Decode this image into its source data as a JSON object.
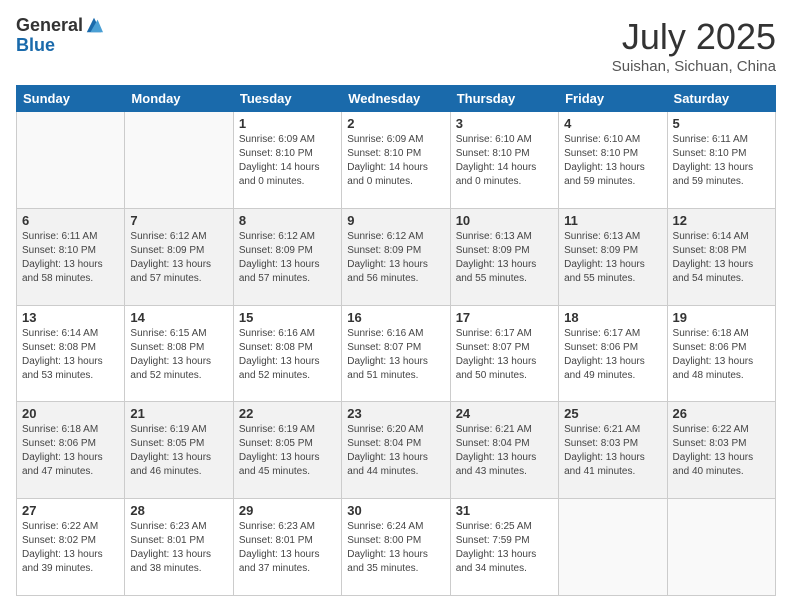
{
  "header": {
    "logo_general": "General",
    "logo_blue": "Blue",
    "month": "July 2025",
    "location": "Suishan, Sichuan, China"
  },
  "weekdays": [
    "Sunday",
    "Monday",
    "Tuesday",
    "Wednesday",
    "Thursday",
    "Friday",
    "Saturday"
  ],
  "weeks": [
    [
      {
        "day": "",
        "info": ""
      },
      {
        "day": "",
        "info": ""
      },
      {
        "day": "1",
        "info": "Sunrise: 6:09 AM\nSunset: 8:10 PM\nDaylight: 14 hours\nand 0 minutes."
      },
      {
        "day": "2",
        "info": "Sunrise: 6:09 AM\nSunset: 8:10 PM\nDaylight: 14 hours\nand 0 minutes."
      },
      {
        "day": "3",
        "info": "Sunrise: 6:10 AM\nSunset: 8:10 PM\nDaylight: 14 hours\nand 0 minutes."
      },
      {
        "day": "4",
        "info": "Sunrise: 6:10 AM\nSunset: 8:10 PM\nDaylight: 13 hours\nand 59 minutes."
      },
      {
        "day": "5",
        "info": "Sunrise: 6:11 AM\nSunset: 8:10 PM\nDaylight: 13 hours\nand 59 minutes."
      }
    ],
    [
      {
        "day": "6",
        "info": "Sunrise: 6:11 AM\nSunset: 8:10 PM\nDaylight: 13 hours\nand 58 minutes."
      },
      {
        "day": "7",
        "info": "Sunrise: 6:12 AM\nSunset: 8:09 PM\nDaylight: 13 hours\nand 57 minutes."
      },
      {
        "day": "8",
        "info": "Sunrise: 6:12 AM\nSunset: 8:09 PM\nDaylight: 13 hours\nand 57 minutes."
      },
      {
        "day": "9",
        "info": "Sunrise: 6:12 AM\nSunset: 8:09 PM\nDaylight: 13 hours\nand 56 minutes."
      },
      {
        "day": "10",
        "info": "Sunrise: 6:13 AM\nSunset: 8:09 PM\nDaylight: 13 hours\nand 55 minutes."
      },
      {
        "day": "11",
        "info": "Sunrise: 6:13 AM\nSunset: 8:09 PM\nDaylight: 13 hours\nand 55 minutes."
      },
      {
        "day": "12",
        "info": "Sunrise: 6:14 AM\nSunset: 8:08 PM\nDaylight: 13 hours\nand 54 minutes."
      }
    ],
    [
      {
        "day": "13",
        "info": "Sunrise: 6:14 AM\nSunset: 8:08 PM\nDaylight: 13 hours\nand 53 minutes."
      },
      {
        "day": "14",
        "info": "Sunrise: 6:15 AM\nSunset: 8:08 PM\nDaylight: 13 hours\nand 52 minutes."
      },
      {
        "day": "15",
        "info": "Sunrise: 6:16 AM\nSunset: 8:08 PM\nDaylight: 13 hours\nand 52 minutes."
      },
      {
        "day": "16",
        "info": "Sunrise: 6:16 AM\nSunset: 8:07 PM\nDaylight: 13 hours\nand 51 minutes."
      },
      {
        "day": "17",
        "info": "Sunrise: 6:17 AM\nSunset: 8:07 PM\nDaylight: 13 hours\nand 50 minutes."
      },
      {
        "day": "18",
        "info": "Sunrise: 6:17 AM\nSunset: 8:06 PM\nDaylight: 13 hours\nand 49 minutes."
      },
      {
        "day": "19",
        "info": "Sunrise: 6:18 AM\nSunset: 8:06 PM\nDaylight: 13 hours\nand 48 minutes."
      }
    ],
    [
      {
        "day": "20",
        "info": "Sunrise: 6:18 AM\nSunset: 8:06 PM\nDaylight: 13 hours\nand 47 minutes."
      },
      {
        "day": "21",
        "info": "Sunrise: 6:19 AM\nSunset: 8:05 PM\nDaylight: 13 hours\nand 46 minutes."
      },
      {
        "day": "22",
        "info": "Sunrise: 6:19 AM\nSunset: 8:05 PM\nDaylight: 13 hours\nand 45 minutes."
      },
      {
        "day": "23",
        "info": "Sunrise: 6:20 AM\nSunset: 8:04 PM\nDaylight: 13 hours\nand 44 minutes."
      },
      {
        "day": "24",
        "info": "Sunrise: 6:21 AM\nSunset: 8:04 PM\nDaylight: 13 hours\nand 43 minutes."
      },
      {
        "day": "25",
        "info": "Sunrise: 6:21 AM\nSunset: 8:03 PM\nDaylight: 13 hours\nand 41 minutes."
      },
      {
        "day": "26",
        "info": "Sunrise: 6:22 AM\nSunset: 8:03 PM\nDaylight: 13 hours\nand 40 minutes."
      }
    ],
    [
      {
        "day": "27",
        "info": "Sunrise: 6:22 AM\nSunset: 8:02 PM\nDaylight: 13 hours\nand 39 minutes."
      },
      {
        "day": "28",
        "info": "Sunrise: 6:23 AM\nSunset: 8:01 PM\nDaylight: 13 hours\nand 38 minutes."
      },
      {
        "day": "29",
        "info": "Sunrise: 6:23 AM\nSunset: 8:01 PM\nDaylight: 13 hours\nand 37 minutes."
      },
      {
        "day": "30",
        "info": "Sunrise: 6:24 AM\nSunset: 8:00 PM\nDaylight: 13 hours\nand 35 minutes."
      },
      {
        "day": "31",
        "info": "Sunrise: 6:25 AM\nSunset: 7:59 PM\nDaylight: 13 hours\nand 34 minutes."
      },
      {
        "day": "",
        "info": ""
      },
      {
        "day": "",
        "info": ""
      }
    ]
  ]
}
